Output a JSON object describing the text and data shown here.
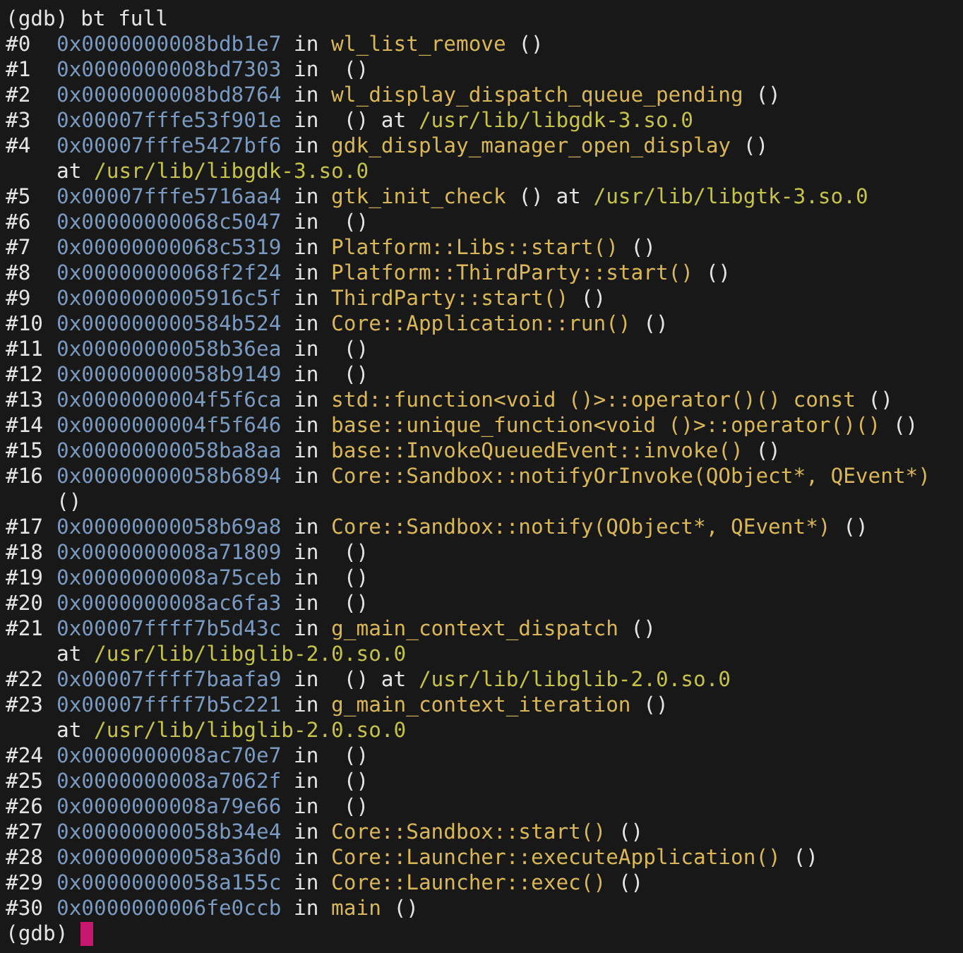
{
  "terminal": {
    "command_line": {
      "prompt": "(gdb)",
      "command": "bt full"
    },
    "frames": [
      {
        "number": "#0",
        "address": "0x0000000008bdb1e7",
        "keyword": "in",
        "function": "wl_list_remove",
        "args": "()"
      },
      {
        "number": "#1",
        "address": "0x0000000008bd7303",
        "keyword": "in",
        "args": "()"
      },
      {
        "number": "#2",
        "address": "0x0000000008bd8764",
        "keyword": "in",
        "function": "wl_display_dispatch_queue_pending",
        "args": "()"
      },
      {
        "number": "#3",
        "address": "0x00007fffe53f901e",
        "keyword": "in",
        "args": "()",
        "location": {
          "keyword": "at",
          "path": "/usr/lib/libgdk-3.so.0",
          "wrapped": false
        }
      },
      {
        "number": "#4",
        "address": "0x00007fffe5427bf6",
        "keyword": "in",
        "function": "gdk_display_manager_open_display",
        "args": "()",
        "location": {
          "keyword": "at",
          "path": "/usr/lib/libgdk-3.so.0",
          "wrapped": true
        }
      },
      {
        "number": "#5",
        "address": "0x00007fffe5716aa4",
        "keyword": "in",
        "function": "gtk_init_check",
        "args": "()",
        "location": {
          "keyword": "at",
          "path": "/usr/lib/libgtk-3.so.0",
          "wrapped": false
        }
      },
      {
        "number": "#6",
        "address": "0x00000000068c5047",
        "keyword": "in",
        "args": "()"
      },
      {
        "number": "#7",
        "address": "0x00000000068c5319",
        "keyword": "in",
        "function": "Platform::Libs::start()",
        "args": "()"
      },
      {
        "number": "#8",
        "address": "0x00000000068f2f24",
        "keyword": "in",
        "function": "Platform::ThirdParty::start()",
        "args": "()"
      },
      {
        "number": "#9",
        "address": "0x0000000005916c5f",
        "keyword": "in",
        "function": "ThirdParty::start()",
        "args": "()"
      },
      {
        "number": "#10",
        "address": "0x000000000584b524",
        "keyword": "in",
        "function": "Core::Application::run()",
        "args": "()"
      },
      {
        "number": "#11",
        "address": "0x00000000058b36ea",
        "keyword": "in",
        "args": "()"
      },
      {
        "number": "#12",
        "address": "0x00000000058b9149",
        "keyword": "in",
        "args": "()"
      },
      {
        "number": "#13",
        "address": "0x0000000004f5f6ca",
        "keyword": "in",
        "function": "std::function<void ()>::operator()() const",
        "args": "()"
      },
      {
        "number": "#14",
        "address": "0x0000000004f5f646",
        "keyword": "in",
        "function": "base::unique_function<void ()>::operator()()",
        "args": "()"
      },
      {
        "number": "#15",
        "address": "0x00000000058ba8aa",
        "keyword": "in",
        "function": "base::InvokeQueuedEvent::invoke()",
        "args": "()"
      },
      {
        "number": "#16",
        "address": "0x00000000058b6894",
        "keyword": "in",
        "function": "Core::Sandbox::notifyOrInvoke(QObject*, QEvent*)",
        "args": "()",
        "args_wrapped": true
      },
      {
        "number": "#17",
        "address": "0x00000000058b69a8",
        "keyword": "in",
        "function": "Core::Sandbox::notify(QObject*, QEvent*)",
        "args": "()"
      },
      {
        "number": "#18",
        "address": "0x0000000008a71809",
        "keyword": "in",
        "args": "()"
      },
      {
        "number": "#19",
        "address": "0x0000000008a75ceb",
        "keyword": "in",
        "args": "()"
      },
      {
        "number": "#20",
        "address": "0x0000000008ac6fa3",
        "keyword": "in",
        "args": "()"
      },
      {
        "number": "#21",
        "address": "0x00007ffff7b5d43c",
        "keyword": "in",
        "function": "g_main_context_dispatch",
        "args": "()",
        "location": {
          "keyword": "at",
          "path": "/usr/lib/libglib-2.0.so.0",
          "wrapped": true
        }
      },
      {
        "number": "#22",
        "address": "0x00007ffff7baafa9",
        "keyword": "in",
        "args": "()",
        "location": {
          "keyword": "at",
          "path": "/usr/lib/libglib-2.0.so.0",
          "wrapped": false
        }
      },
      {
        "number": "#23",
        "address": "0x00007ffff7b5c221",
        "keyword": "in",
        "function": "g_main_context_iteration",
        "args": "()",
        "location": {
          "keyword": "at",
          "path": "/usr/lib/libglib-2.0.so.0",
          "wrapped": true
        }
      },
      {
        "number": "#24",
        "address": "0x0000000008ac70e7",
        "keyword": "in",
        "args": "()"
      },
      {
        "number": "#25",
        "address": "0x0000000008a7062f",
        "keyword": "in",
        "args": "()"
      },
      {
        "number": "#26",
        "address": "0x0000000008a79e66",
        "keyword": "in",
        "args": "()"
      },
      {
        "number": "#27",
        "address": "0x00000000058b34e4",
        "keyword": "in",
        "function": "Core::Sandbox::start()",
        "args": "()"
      },
      {
        "number": "#28",
        "address": "0x00000000058a36d0",
        "keyword": "in",
        "function": "Core::Launcher::executeApplication()",
        "args": "()"
      },
      {
        "number": "#29",
        "address": "0x00000000058a155c",
        "keyword": "in",
        "function": "Core::Launcher::exec()",
        "args": "()"
      },
      {
        "number": "#30",
        "address": "0x0000000006fe0ccb",
        "keyword": "in",
        "function": "main",
        "args": "()"
      }
    ],
    "input_line": {
      "prompt": "(gdb)"
    }
  }
}
